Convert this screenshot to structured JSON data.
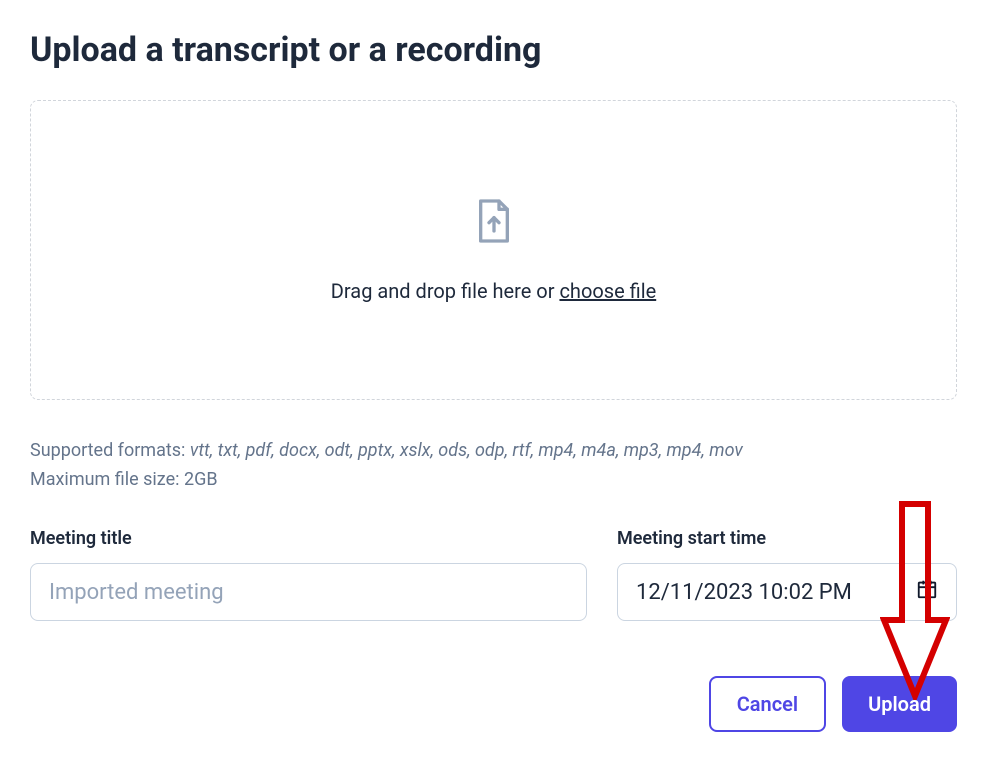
{
  "title": "Upload a transcript or a recording",
  "dropzone": {
    "prompt_prefix": "Drag and drop file here or ",
    "choose_link": "choose file"
  },
  "info": {
    "supported_label": "Supported formats: ",
    "supported_list": "vtt, txt, pdf, docx, odt, pptx, xslx, ods, odp, rtf, mp4, m4a, mp3, mp4, mov",
    "max_size_label": "Maximum file size: ",
    "max_size_value": "2GB"
  },
  "fields": {
    "meeting_title": {
      "label": "Meeting title",
      "placeholder": "Imported meeting",
      "value": ""
    },
    "start_time": {
      "label": "Meeting start time",
      "value": "12/11/2023 10:02 PM"
    }
  },
  "actions": {
    "cancel": "Cancel",
    "upload": "Upload"
  }
}
